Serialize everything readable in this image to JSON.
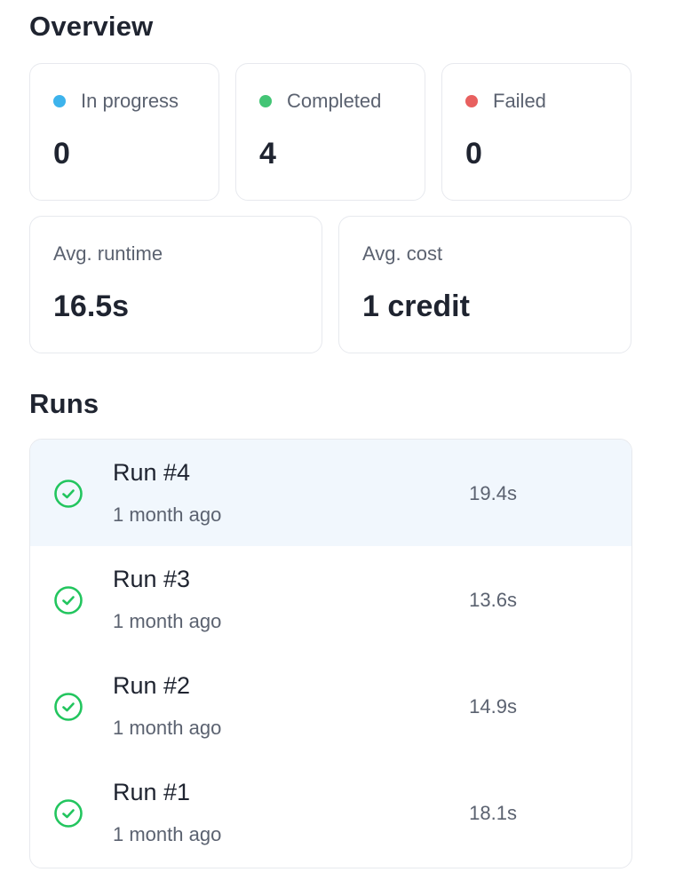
{
  "overview": {
    "title": "Overview",
    "stats": [
      {
        "label": "In progress",
        "value": "0",
        "dot_color": "#3db3ec"
      },
      {
        "label": "Completed",
        "value": "4",
        "dot_color": "#43c575"
      },
      {
        "label": "Failed",
        "value": "0",
        "dot_color": "#e8605f"
      }
    ],
    "metrics": [
      {
        "label": "Avg. runtime",
        "value": "16.5s"
      },
      {
        "label": "Avg. cost",
        "value": "1 credit"
      }
    ]
  },
  "runs": {
    "title": "Runs",
    "status_icon": "check-circle-icon",
    "status_color": "#22c55e",
    "selected_index": 0,
    "items": [
      {
        "name": "Run #4",
        "time": "1 month ago",
        "duration": "19.4s",
        "status": "completed"
      },
      {
        "name": "Run #3",
        "time": "1 month ago",
        "duration": "13.6s",
        "status": "completed"
      },
      {
        "name": "Run #2",
        "time": "1 month ago",
        "duration": "14.9s",
        "status": "completed"
      },
      {
        "name": "Run #1",
        "time": "1 month ago",
        "duration": "18.1s",
        "status": "completed"
      }
    ]
  }
}
